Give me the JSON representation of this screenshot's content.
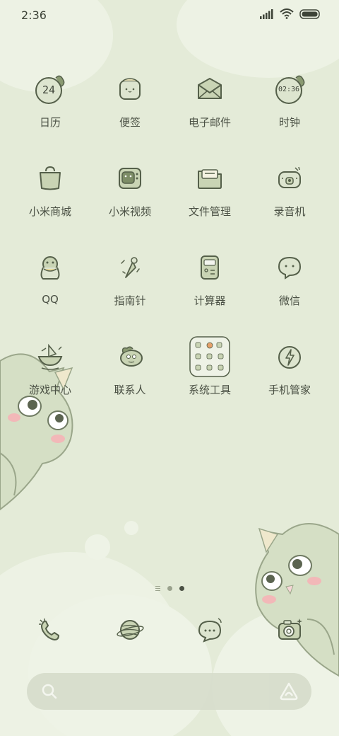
{
  "status_bar": {
    "time": "2:36"
  },
  "apps": [
    {
      "label": "日历",
      "icon": "calendar-icon",
      "badge": "24"
    },
    {
      "label": "便签",
      "icon": "notes-icon"
    },
    {
      "label": "电子邮件",
      "icon": "email-icon"
    },
    {
      "label": "时钟",
      "icon": "clock-icon",
      "badge": "02:36"
    },
    {
      "label": "小米商城",
      "icon": "shopping-bag-icon"
    },
    {
      "label": "小米视频",
      "icon": "video-tv-icon"
    },
    {
      "label": "文件管理",
      "icon": "folder-icon"
    },
    {
      "label": "录音机",
      "icon": "recorder-icon"
    },
    {
      "label": "QQ",
      "icon": "qq-penguin-icon"
    },
    {
      "label": "指南针",
      "icon": "compass-icon"
    },
    {
      "label": "计算器",
      "icon": "calculator-icon"
    },
    {
      "label": "微信",
      "icon": "wechat-icon"
    },
    {
      "label": "游戏中心",
      "icon": "game-boat-icon"
    },
    {
      "label": "联系人",
      "icon": "contacts-dino-icon"
    },
    {
      "label": "系统工具",
      "icon": "system-tools-folder-icon"
    },
    {
      "label": "手机管家",
      "icon": "security-bolt-icon"
    }
  ],
  "dock": [
    {
      "icon": "phone-icon"
    },
    {
      "icon": "browser-planet-icon"
    },
    {
      "icon": "messages-icon"
    },
    {
      "icon": "camera-icon"
    }
  ],
  "page_indicator": {
    "pages": 2,
    "active": 2
  },
  "colors": {
    "background": "#e4ebd8",
    "icon_stroke": "#55604a",
    "icon_fill": "#c9d4b4"
  }
}
